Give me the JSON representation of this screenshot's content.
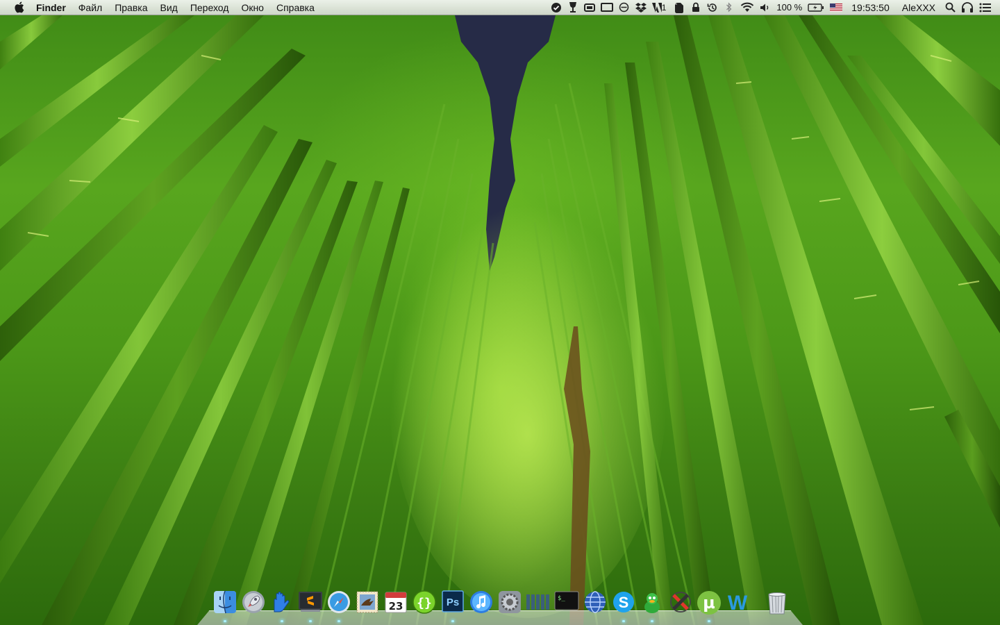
{
  "menubar": {
    "app_name": "Finder",
    "menus": [
      "Файл",
      "Правка",
      "Вид",
      "Переход",
      "Окно",
      "Справка"
    ],
    "status": {
      "adobe_badge": "1",
      "battery_percent": "100 %",
      "input_flag": "us-flag-icon",
      "clock": "19:53:50",
      "user": "AleXXX"
    },
    "tray_icons": [
      "check-shield-icon",
      "wine-glass-icon",
      "gamepad-icon",
      "display-icon",
      "sync-circle-icon",
      "dropbox-icon",
      "adobe-icon",
      "evernote-icon",
      "lock-icon",
      "time-machine-icon",
      "bluetooth-icon",
      "wifi-icon",
      "volume-icon",
      "battery-icon",
      "spotlight-icon",
      "notification-center-icon"
    ]
  },
  "dock": {
    "items": [
      {
        "name": "finder",
        "icon": "finder-icon",
        "running": true
      },
      {
        "name": "launchpad",
        "icon": "launchpad-rocket-icon",
        "running": false
      },
      {
        "name": "cloud-app",
        "icon": "blue-hand-icon",
        "running": true
      },
      {
        "name": "sublime-text",
        "icon": "sublime-text-icon",
        "running": true
      },
      {
        "name": "safari",
        "icon": "safari-compass-icon",
        "running": true
      },
      {
        "name": "mail-stamp",
        "icon": "mail-eagle-icon",
        "running": false
      },
      {
        "name": "calendar",
        "icon": "calendar-icon",
        "running": false,
        "label": "23"
      },
      {
        "name": "code-brackets",
        "icon": "curly-brackets-icon",
        "running": false
      },
      {
        "name": "photoshop",
        "icon": "photoshop-icon",
        "running": true,
        "label": "Ps"
      },
      {
        "name": "itunes",
        "icon": "itunes-note-icon",
        "running": false
      },
      {
        "name": "system-preferences",
        "icon": "gear-icon",
        "running": false
      },
      {
        "name": "bars-app",
        "icon": "bar-blocks-icon",
        "running": false
      },
      {
        "name": "terminal",
        "icon": "terminal-icon",
        "running": false,
        "label": "$_"
      },
      {
        "name": "globe-app",
        "icon": "globe-icon",
        "running": false
      },
      {
        "name": "skype",
        "icon": "skype-icon",
        "running": true,
        "label": "S"
      },
      {
        "name": "adium",
        "icon": "adium-duck-icon",
        "running": true
      },
      {
        "name": "crossover",
        "icon": "crossover-x-icon",
        "running": false
      },
      {
        "name": "utorrent",
        "icon": "utorrent-icon",
        "running": true,
        "label": "µ"
      },
      {
        "name": "word-app",
        "icon": "w-letter-icon",
        "running": false,
        "label": "W"
      }
    ],
    "trash": {
      "name": "trash",
      "icon": "trash-icon"
    }
  },
  "colors": {
    "wallpaper_green": "#4c9818",
    "sky_gap": "#2a2f4a",
    "menubar_bg": "#ececec",
    "dock_indicator": "#aef3ff"
  }
}
